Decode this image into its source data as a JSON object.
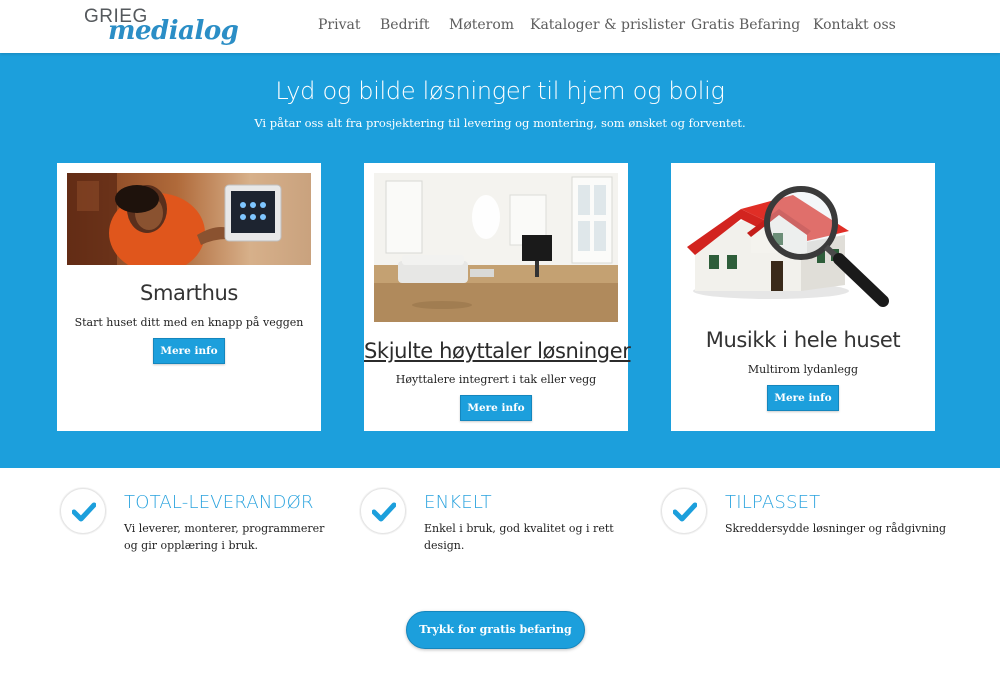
{
  "header": {
    "logo": {
      "top": "GRIEG",
      "script": "medialog"
    },
    "nav": [
      {
        "label": "Privat"
      },
      {
        "label": "Bedrift"
      },
      {
        "label": "Møterom"
      },
      {
        "label": "Kataloger & prislister"
      },
      {
        "label": "Gratis Befaring"
      },
      {
        "label": "Kontakt oss"
      }
    ]
  },
  "hero": {
    "title": "Lyd og bilde løsninger til hjem og bolig",
    "subtitle": "Vi påtar oss alt fra prosjektering til levering og montering, som ønsket og forventet."
  },
  "cards": [
    {
      "title": "Smarthus",
      "text": "Start huset ditt med en knapp på veggen",
      "button": "Mere info"
    },
    {
      "title": "Skjulte høyttaler løsninger",
      "text": "Høyttalere integrert i tak eller vegg",
      "button": "Mere info"
    },
    {
      "title": "Musikk i hele huset",
      "text": "Multirom lydanlegg",
      "button": "Mere info"
    }
  ],
  "features": [
    {
      "title": "TOTAL-LEVERANDØR",
      "text": "Vi leverer, monterer, programmerer og gir opplæring i bruk."
    },
    {
      "title": "ENKELT",
      "text": "Enkel i bruk, god kvalitet og i rett design."
    },
    {
      "title": "TILPASSET",
      "text": "Skreddersydde løsninger og rådgivning"
    }
  ],
  "cta": {
    "label": "Trykk for gratis befaring"
  },
  "colors": {
    "accent": "#1c9fdc",
    "feature_title": "#2aa3de"
  }
}
